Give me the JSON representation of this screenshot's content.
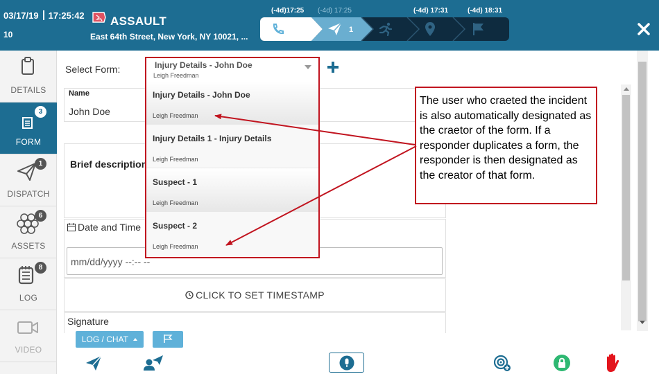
{
  "header": {
    "date": "03/17/19",
    "time": "17:25:42",
    "number": "10",
    "title": "ASSAULT",
    "address": "East 64th Street, New York, NY 10021, ...",
    "timeline": [
      {
        "label": "(-4d)17:25",
        "dim": false
      },
      {
        "label": "(-4d) 17:25",
        "dim": true
      },
      {
        "label": "(-4d) 17:31",
        "dim": false
      },
      {
        "label": "(-4d) 18:31",
        "dim": false
      }
    ],
    "progress_step_count": "1",
    "icons": [
      "phone-icon",
      "paper-plane-icon",
      "running-person-icon",
      "map-pin-icon",
      "flag-icon",
      "close-icon"
    ]
  },
  "sidebar": {
    "items": [
      {
        "label": "DETAILS",
        "icon": "clipboard-icon",
        "badge": null
      },
      {
        "label": "FORM",
        "icon": "form-icon",
        "badge": "3"
      },
      {
        "label": "DISPATCH",
        "icon": "paper-plane-icon",
        "badge": "1"
      },
      {
        "label": "ASSETS",
        "icon": "hexagons-icon",
        "badge": "6"
      },
      {
        "label": "LOG",
        "icon": "log-icon",
        "badge": "8"
      },
      {
        "label": "VIDEO",
        "icon": "video-camera-icon",
        "badge": null
      }
    ]
  },
  "form": {
    "select_label": "Select Form:",
    "selected_title": "Injury Details - John Doe",
    "selected_creator": "Leigh Freedman",
    "name_label": "Name",
    "name_value": "John Doe",
    "brief_label": "Brief description",
    "datetime_label": "Date and Time",
    "datetime_placeholder": "mm/dd/yyyy  --:--  --",
    "timestamp_button": "CLICK TO SET TIMESTAMP",
    "signature_label": "Signature",
    "logchat_label": "LOG / CHAT"
  },
  "dropdown": {
    "options": [
      {
        "title": "Injury Details - John Doe",
        "creator": "Leigh Freedman"
      },
      {
        "title": "Injury Details 1 - Injury Details",
        "creator": "Leigh Freedman"
      },
      {
        "title": "Suspect - 1",
        "creator": "Leigh Freedman"
      },
      {
        "title": "Suspect - 2",
        "creator": "Leigh Freedman"
      }
    ]
  },
  "annotation": {
    "text": "The user who craeted the incident is also automatically designated as the craetor of the form. If a responder duplicates a form, the responder is then designated as the creator of that form."
  },
  "colors": {
    "header": "#1d6d92",
    "accent_light": "#5fb1d9",
    "annotation_red": "#c1141f",
    "lock_green": "#2eb872",
    "hand_red": "#e3141c"
  }
}
